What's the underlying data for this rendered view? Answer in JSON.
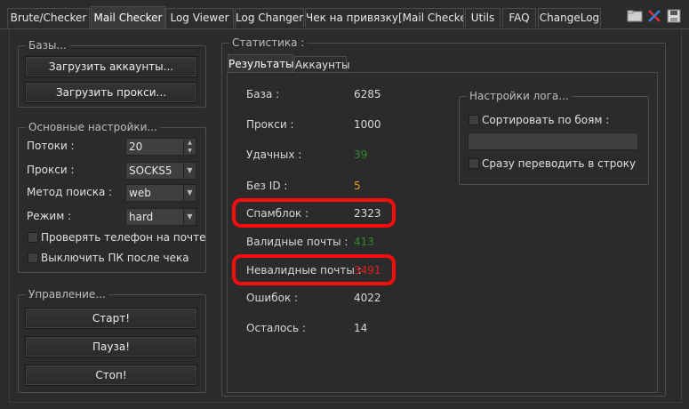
{
  "tabs": [
    {
      "label": "Brute/Checker",
      "active": false
    },
    {
      "label": "Mail Checker",
      "active": true
    },
    {
      "label": "Log  Viewer",
      "active": false
    },
    {
      "label": "Log Changer",
      "active": false
    },
    {
      "label": "Чек на привязку[Mail Checker]",
      "active": false
    },
    {
      "label": "Utils",
      "active": false
    },
    {
      "label": "FAQ",
      "active": false
    },
    {
      "label": "ChangeLog",
      "active": false
    }
  ],
  "toolbar_icons": [
    "folder-icon",
    "tools-icon",
    "save-icon"
  ],
  "bases": {
    "title": "Базы...",
    "load_accounts": "Загрузить аккаунты...",
    "load_proxies": "Загрузить прокси..."
  },
  "settings": {
    "title": "Основные настройки...",
    "threads_label": "Потоки :",
    "threads_value": "20",
    "proxy_label": "Прокси :",
    "proxy_value": "SOCKS5",
    "method_label": "Метод поиска :",
    "method_value": "web",
    "mode_label": "Режим  :",
    "mode_value": "hard",
    "check_phone": "Проверять телефон на почте",
    "shutdown_pc": "Выключить ПК после чека"
  },
  "control": {
    "title": "Управление...",
    "start": "Старт!",
    "pause": "Пауза!",
    "stop": "Стоп!"
  },
  "stats": {
    "title": "Статистика :",
    "tab_results": "Результаты",
    "tab_accounts": "Аккаунты",
    "rows": [
      {
        "label": "База :",
        "value": "6285",
        "color": "#d8d8d8"
      },
      {
        "label": "Прокси :",
        "value": "1000",
        "color": "#d8d8d8"
      },
      {
        "label": "Удачных :",
        "value": "39",
        "color": "#2e8b2e"
      },
      {
        "label": "Без ID :",
        "value": "5",
        "color": "#e8a020"
      },
      {
        "label": "Спамблок :",
        "value": "2323",
        "color": "#d8d8d8"
      },
      {
        "label": "Валидные почты :",
        "value": "413",
        "color": "#2e8b2e"
      },
      {
        "label": "Невалидные почты :",
        "value": "3491",
        "color": "#e02020"
      },
      {
        "label": "Ошибок :",
        "value": "4022",
        "color": "#d8d8d8"
      },
      {
        "label": "Осталось :",
        "value": "14",
        "color": "#d8d8d8"
      }
    ]
  },
  "log_settings": {
    "title": "Настройки лога...",
    "sort_by_fights": "Сортировать по боям :",
    "to_line": "Сразу переводить в строку"
  },
  "colors": {
    "highlight": "#ff0a0a",
    "background": "#2b2b2b"
  }
}
